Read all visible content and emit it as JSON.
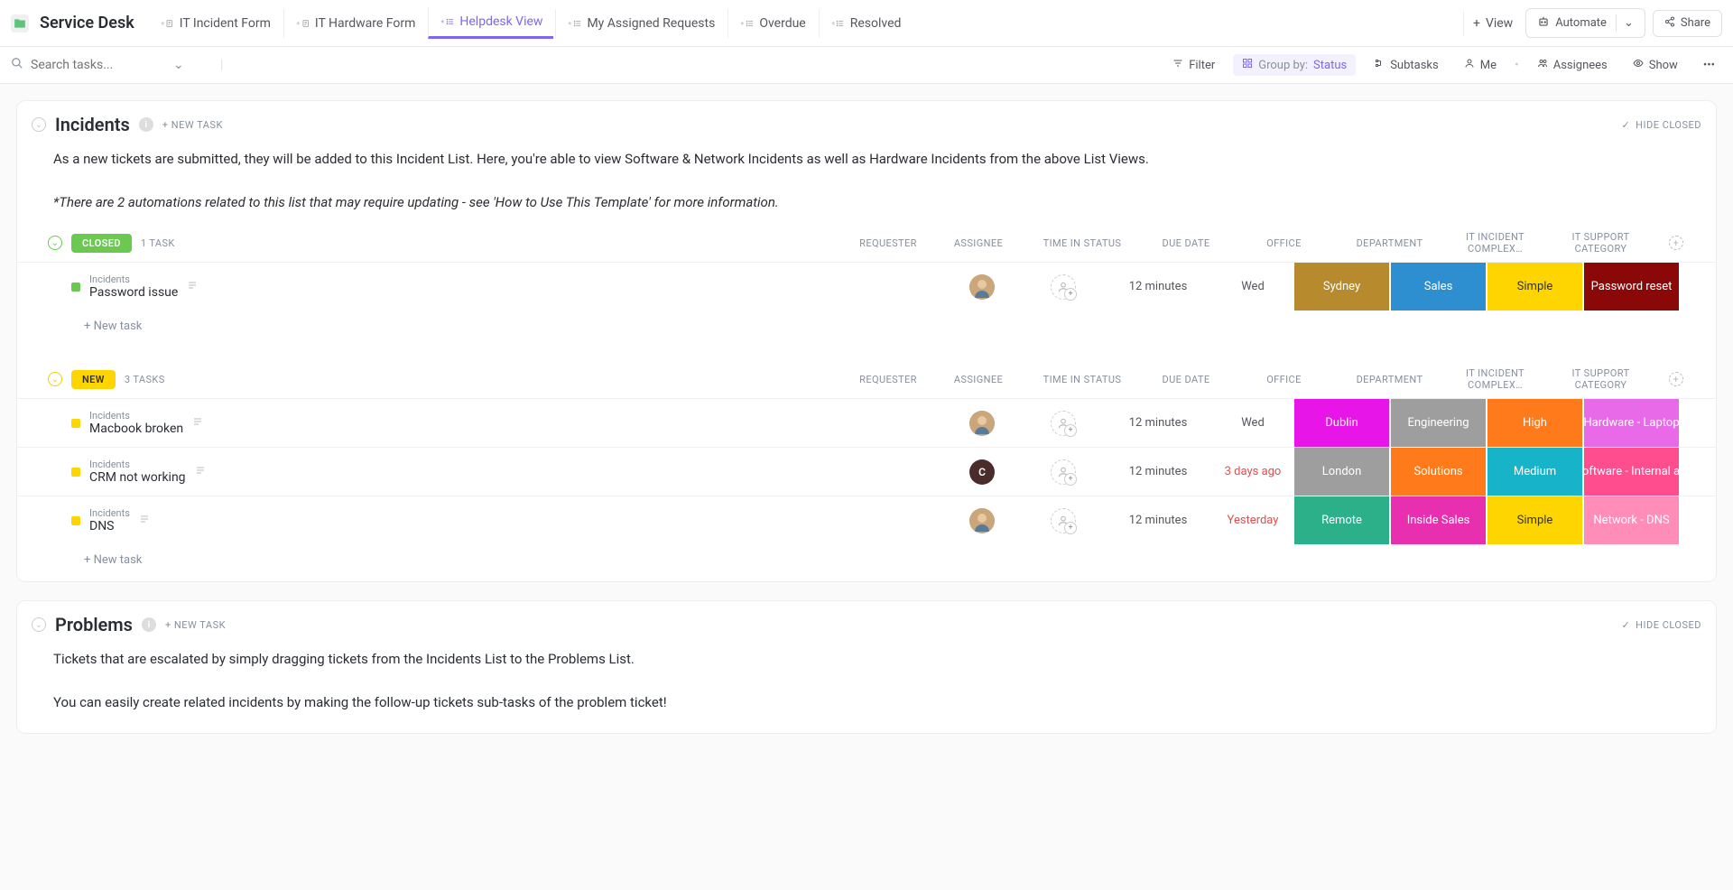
{
  "app": {
    "title": "Service Desk"
  },
  "tabs": [
    {
      "label": "IT Incident Form",
      "icon": "form"
    },
    {
      "label": "IT Hardware Form",
      "icon": "form"
    },
    {
      "label": "Helpdesk View",
      "icon": "list",
      "active": true
    },
    {
      "label": "My Assigned Requests",
      "icon": "list"
    },
    {
      "label": "Overdue",
      "icon": "list"
    },
    {
      "label": "Resolved",
      "icon": "list"
    }
  ],
  "viewBtn": "View",
  "topActions": {
    "automate": "Automate",
    "share": "Share"
  },
  "search": {
    "placeholder": "Search tasks..."
  },
  "toolbar": {
    "filter": "Filter",
    "groupByLabel": "Group by:",
    "groupByValue": "Status",
    "subtasks": "Subtasks",
    "me": "Me",
    "assignees": "Assignees",
    "show": "Show"
  },
  "sections": {
    "incidents": {
      "title": "Incidents",
      "newTask": "+ NEW TASK",
      "hideClosed": "HIDE CLOSED",
      "desc1": "As a new tickets are submitted, they will be added to this Incident List. Here, you're able to view Software & Network Incidents as well as Hardware Incidents from the above List Views.",
      "desc2": "*There are 2 automations related to this list that may require updating - see 'How to Use This Template' for more information."
    },
    "problems": {
      "title": "Problems",
      "newTask": "+ NEW TASK",
      "hideClosed": "HIDE CLOSED",
      "desc1": "Tickets that are escalated by simply dragging tickets from the Incidents List to the Problems List.",
      "desc2": "You can easily create related incidents by making the follow-up tickets sub-tasks of the problem ticket!"
    }
  },
  "columns": {
    "requester": "REQUESTER",
    "assignee": "ASSIGNEE",
    "timeInStatus": "TIME IN STATUS",
    "dueDate": "DUE DATE",
    "office": "OFFICE",
    "department": "DEPARTMENT",
    "complexity": "IT INCIDENT COMPLEX…",
    "category": "IT SUPPORT CATEGORY"
  },
  "groups": {
    "closed": {
      "label": "CLOSED",
      "count": "1 TASK"
    },
    "new": {
      "label": "NEW",
      "count": "3 TASKS"
    }
  },
  "newTaskRow": "+ New task",
  "parentName": "Incidents",
  "tasks": {
    "closed": [
      {
        "name": "Password issue",
        "requester": "avatar",
        "time": "12 minutes",
        "due": "Wed",
        "office": {
          "text": "Sydney",
          "bg": "#b88a2e"
        },
        "dept": {
          "text": "Sales",
          "bg": "#2e8fd0"
        },
        "complexity": {
          "text": "Simple",
          "bg": "#ffd500",
          "fg": "#333"
        },
        "category": {
          "text": "Password reset",
          "bg": "#8a0808"
        }
      }
    ],
    "new": [
      {
        "name": "Macbook broken",
        "requester": "avatar",
        "time": "12 minutes",
        "due": "Wed",
        "office": {
          "text": "Dublin",
          "bg": "#e815e8"
        },
        "dept": {
          "text": "Engineering",
          "bg": "#9e9e9e"
        },
        "complexity": {
          "text": "High",
          "bg": "#ff7a1a"
        },
        "category": {
          "text": "Hardware - Laptop",
          "bg": "#e86ae8"
        }
      },
      {
        "name": "CRM not working",
        "requester": "letterC",
        "time": "12 minutes",
        "due": "3 days ago",
        "dueOverdue": true,
        "office": {
          "text": "London",
          "bg": "#9e9e9e"
        },
        "dept": {
          "text": "Solutions",
          "bg": "#ff7a1a"
        },
        "complexity": {
          "text": "Medium",
          "bg": "#17b3c9"
        },
        "category": {
          "text": "Software - Internal a…",
          "bg": "#ff4d8d"
        }
      },
      {
        "name": "DNS",
        "requester": "avatar",
        "time": "12 minutes",
        "due": "Yesterday",
        "dueOverdue": true,
        "office": {
          "text": "Remote",
          "bg": "#2bb08a"
        },
        "dept": {
          "text": "Inside Sales",
          "bg": "#e82fb0"
        },
        "complexity": {
          "text": "Simple",
          "bg": "#ffd500",
          "fg": "#333"
        },
        "category": {
          "text": "Network - DNS",
          "bg": "#ff8db8"
        }
      }
    ]
  }
}
